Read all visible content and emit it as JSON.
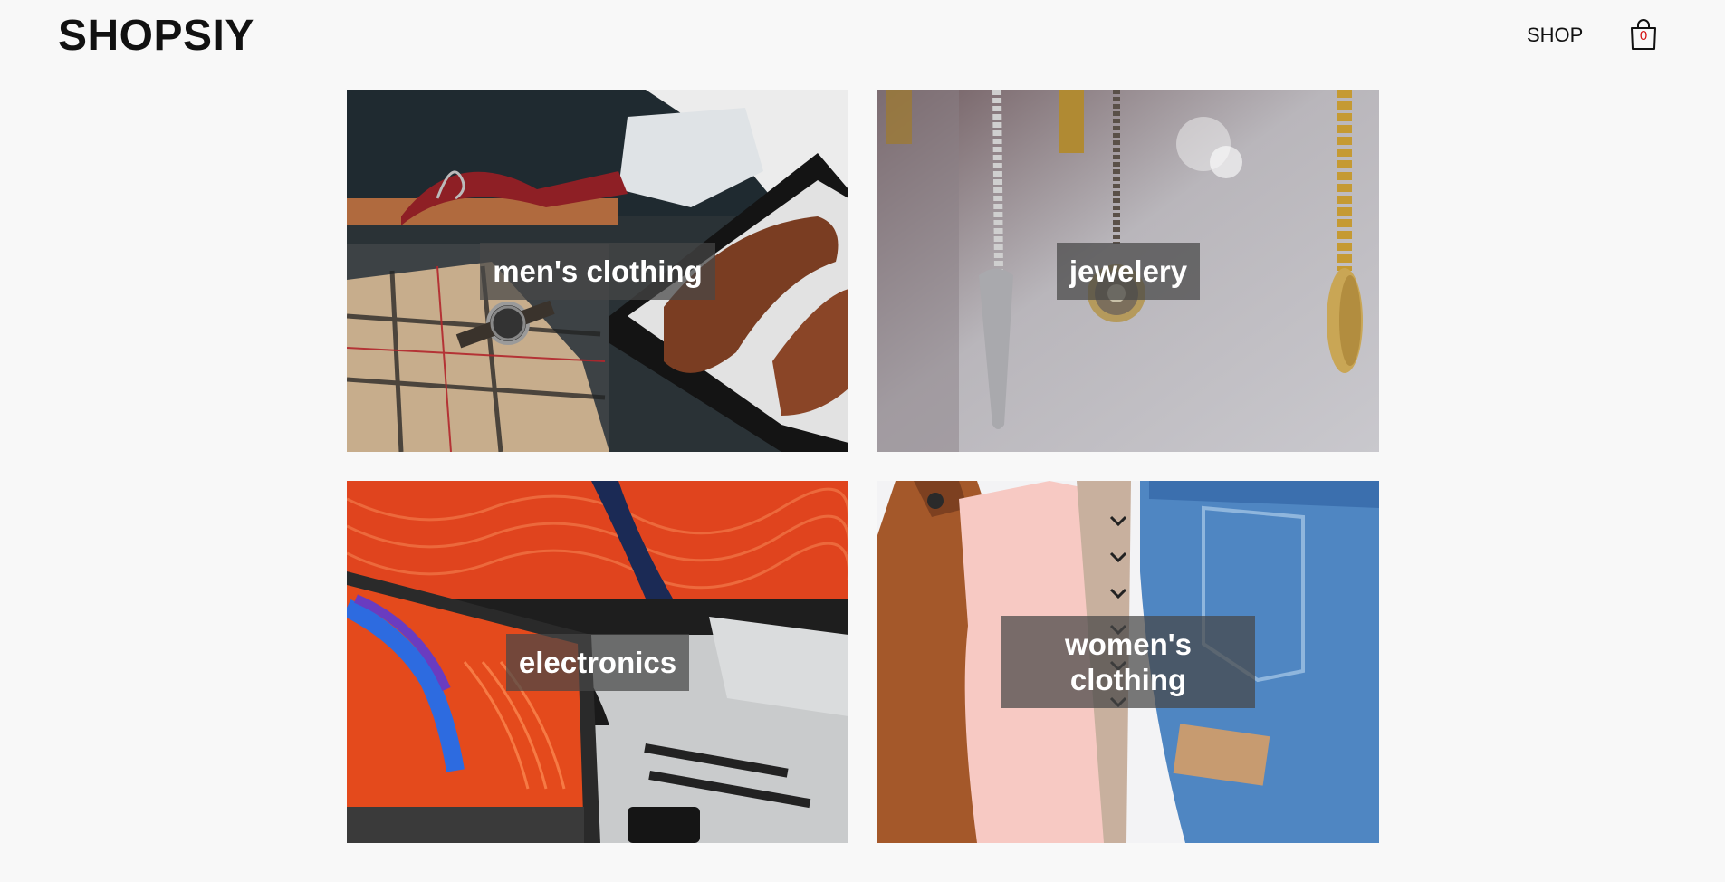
{
  "header": {
    "logo": "SHOPSIY",
    "nav_shop": "SHOP",
    "cart_count": "0"
  },
  "categories": [
    {
      "label": "men's clothing",
      "image": "men's clothing flat-lay"
    },
    {
      "label": "jewelery",
      "image": "hanging chains and pendants"
    },
    {
      "label": "electronics",
      "image": "monitor and laptop"
    },
    {
      "label": "women's clothing",
      "image": "clothes on rack"
    }
  ],
  "colors": {
    "background": "#f8f8f8",
    "text": "#111111",
    "cart_count": "#d41010",
    "label_bg": "rgba(70,70,70,0.72)",
    "label_text": "#ffffff"
  }
}
